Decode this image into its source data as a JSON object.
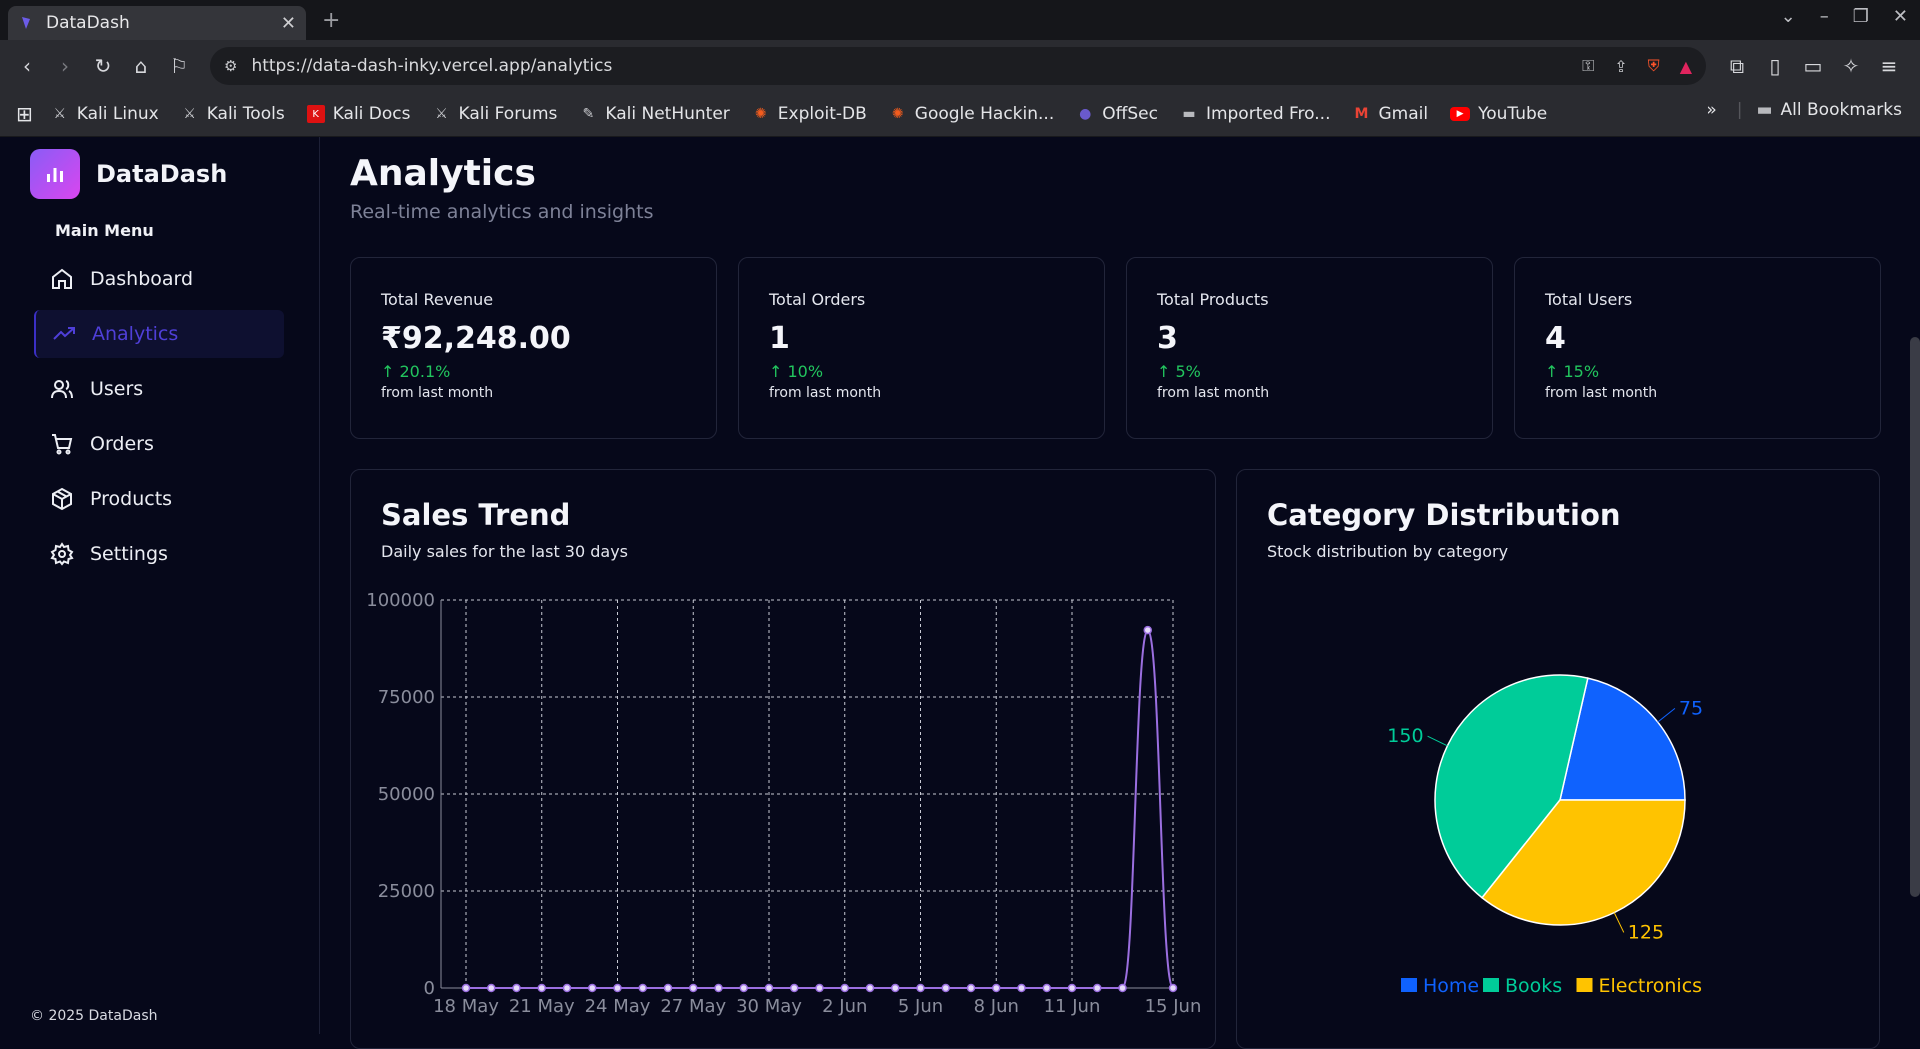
{
  "browser": {
    "tab_title": "DataDash",
    "url": "https://data-dash-inky.vercel.app/analytics",
    "bookmarks": [
      {
        "label": "Kali Linux",
        "icon": "kali-icon"
      },
      {
        "label": "Kali Tools",
        "icon": "kali-icon"
      },
      {
        "label": "Kali Docs",
        "icon": "kali-docs-icon"
      },
      {
        "label": "Kali Forums",
        "icon": "kali-icon"
      },
      {
        "label": "Kali NetHunter",
        "icon": "nethunter-icon"
      },
      {
        "label": "Exploit-DB",
        "icon": "exploit-icon"
      },
      {
        "label": "Google Hackin...",
        "icon": "exploit-icon"
      },
      {
        "label": "OffSec",
        "icon": "offsec-icon"
      },
      {
        "label": "Imported Fro...",
        "icon": "folder-icon"
      },
      {
        "label": "Gmail",
        "icon": "gmail-icon"
      },
      {
        "label": "YouTube",
        "icon": "youtube-icon"
      }
    ],
    "all_bookmarks": "All Bookmarks"
  },
  "sidebar": {
    "brand": "DataDash",
    "menu_label": "Main Menu",
    "items": [
      {
        "label": "Dashboard",
        "icon": "home-icon"
      },
      {
        "label": "Analytics",
        "icon": "trending-up-icon"
      },
      {
        "label": "Users",
        "icon": "users-icon"
      },
      {
        "label": "Orders",
        "icon": "cart-icon"
      },
      {
        "label": "Products",
        "icon": "box-icon"
      },
      {
        "label": "Settings",
        "icon": "gear-icon"
      }
    ],
    "active": "Analytics",
    "copyright": "© 2025 DataDash"
  },
  "main": {
    "title": "Analytics",
    "subtitle": "Real-time analytics and insights",
    "cards": [
      {
        "label": "Total Revenue",
        "value": "₹92,248.00",
        "change": "20.1%",
        "note": "from last month"
      },
      {
        "label": "Total Orders",
        "value": "1",
        "change": "10%",
        "note": "from last month"
      },
      {
        "label": "Total Products",
        "value": "3",
        "change": "5%",
        "note": "from last month"
      },
      {
        "label": "Total Users",
        "value": "4",
        "change": "15%",
        "note": "from last month"
      }
    ],
    "sales_panel": {
      "title": "Sales Trend",
      "subtitle": "Daily sales for the last 30 days"
    },
    "category_panel": {
      "title": "Category Distribution",
      "subtitle": "Stock distribution by category"
    }
  },
  "colors": {
    "line": "#9b6fe0",
    "home": "#0f62fe",
    "books": "#00cc99",
    "electronics": "#ffc300",
    "up": "#22c55e"
  },
  "chart_data": [
    {
      "type": "line",
      "x_ticks": [
        "18 May",
        "21 May",
        "24 May",
        "27 May",
        "30 May",
        "2 Jun",
        "5 Jun",
        "8 Jun",
        "11 Jun",
        "15 Jun"
      ],
      "x": [
        "18 May",
        "19 May",
        "20 May",
        "21 May",
        "22 May",
        "23 May",
        "24 May",
        "25 May",
        "26 May",
        "27 May",
        "28 May",
        "29 May",
        "30 May",
        "31 May",
        "1 Jun",
        "2 Jun",
        "3 Jun",
        "4 Jun",
        "5 Jun",
        "6 Jun",
        "7 Jun",
        "8 Jun",
        "9 Jun",
        "10 Jun",
        "11 Jun",
        "12 Jun",
        "13 Jun",
        "14 Jun",
        "15 Jun"
      ],
      "values": [
        0,
        0,
        0,
        0,
        0,
        0,
        0,
        0,
        0,
        0,
        0,
        0,
        0,
        0,
        0,
        0,
        0,
        0,
        0,
        0,
        0,
        0,
        0,
        0,
        0,
        0,
        0,
        92248,
        0,
        0
      ],
      "ylim": [
        0,
        100000
      ],
      "y_ticks": [
        0,
        25000,
        50000,
        75000,
        100000
      ],
      "grid": true
    },
    {
      "type": "pie",
      "categories": [
        "Home",
        "Books",
        "Electronics"
      ],
      "values": [
        75,
        150,
        125
      ],
      "legend": "bottom"
    }
  ]
}
